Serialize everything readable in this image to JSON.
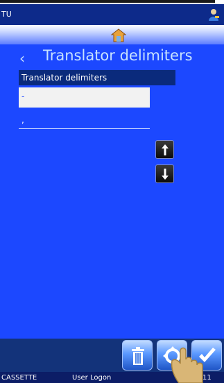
{
  "titlebar": {
    "text": "TU",
    "user_icon": "user-keys-icon"
  },
  "homebar": {
    "home_icon": "home-icon"
  },
  "page": {
    "title": "Translator delimiters",
    "back_icon": "chevron-left-icon"
  },
  "list": {
    "header": "Translator delimiters",
    "items": [
      {
        "text": "-"
      },
      {
        "text": ","
      }
    ]
  },
  "arrows": {
    "up_icon": "arrow-up-icon",
    "down_icon": "arrow-down-icon"
  },
  "toolbar": {
    "delete_icon": "trash-icon",
    "move_icon": "move-icon",
    "ok_icon": "checkmark-icon"
  },
  "status": {
    "left": "CASSETTE",
    "middle": "User Logon",
    "right": "11"
  },
  "colors": {
    "main_bg": "#1c48ff",
    "title_blue": "#c7e2ff",
    "titlebar": "#0d2a8a"
  }
}
